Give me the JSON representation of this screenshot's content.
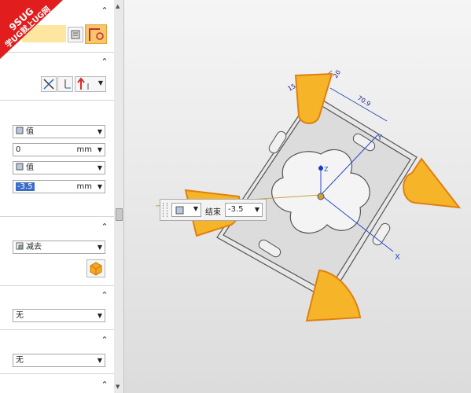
{
  "badge": {
    "line1": "9SUG",
    "line2": "学UG就上UG网"
  },
  "start": {
    "type": "值",
    "value": "0",
    "unit": "mm"
  },
  "end": {
    "type": "值",
    "value": "-3.5",
    "unit": "mm"
  },
  "boolean": {
    "operation": "减去"
  },
  "draft": {
    "value": "无"
  },
  "offset": {
    "value": "无"
  },
  "onscreen": {
    "label": "结束",
    "value": "-3.5"
  },
  "dims": {
    "d1": "15.4",
    "d2": "70.9",
    "d3": "20"
  },
  "axes": {
    "x": "X",
    "y": "Y",
    "z": "Z"
  }
}
